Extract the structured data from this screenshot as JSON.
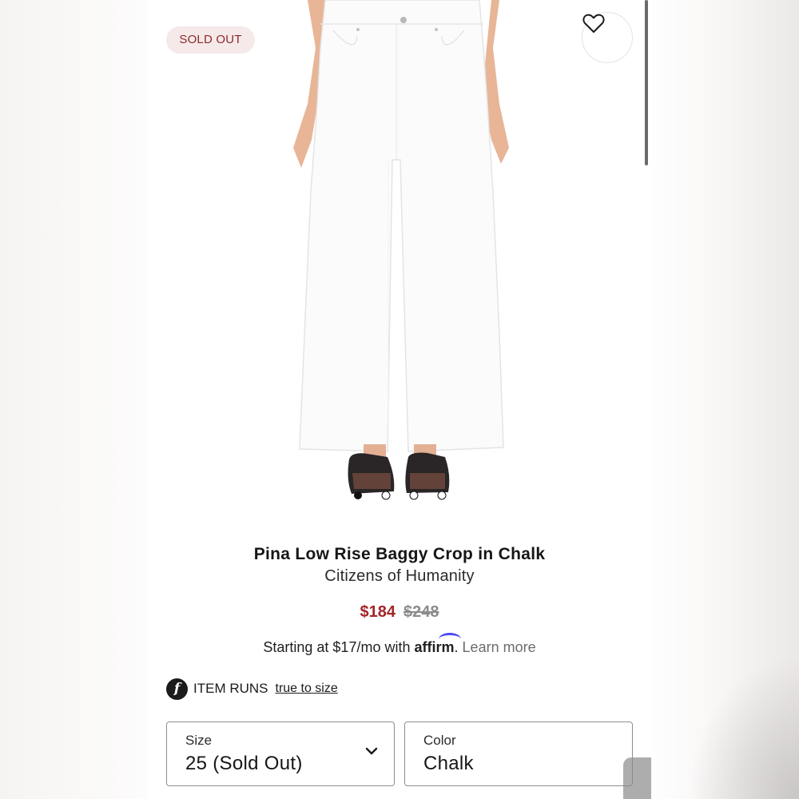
{
  "badge": {
    "sold_out": "SOLD OUT"
  },
  "product": {
    "title": "Pina Low Rise Baggy Crop in Chalk",
    "brand": "Citizens of Humanity",
    "price_sale": "$184",
    "price_original": "$248"
  },
  "financing": {
    "prefix": "Starting at $17/mo with",
    "provider": "affirm",
    "suffix": ".",
    "learn_more": "Learn more"
  },
  "fit": {
    "icon_letter": "f",
    "label": "ITEM RUNS",
    "link": "true to size"
  },
  "size_select": {
    "label": "Size",
    "value": "25 (Sold Out)"
  },
  "color_select": {
    "label": "Color",
    "value": "Chalk"
  },
  "icons": {
    "favorite": "heart-outline-icon",
    "dropdown": "chevron-down-icon",
    "fit": "fit-predictor-icon"
  },
  "colors": {
    "sale_price": "#a3262a",
    "badge_bg": "#f6e9e9",
    "badge_text": "#8a2b2b",
    "affirm_arc": "#4a4af4"
  }
}
